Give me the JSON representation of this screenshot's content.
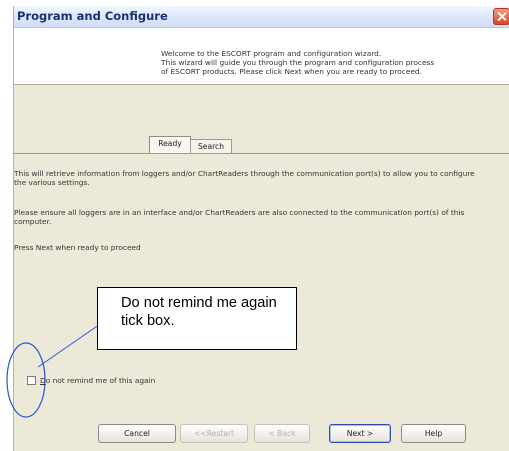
{
  "window": {
    "title": "Program and Configure"
  },
  "header": {
    "lines": [
      "Welcome to the ESCORT program and configuration wizard.",
      "This wizard will guide you through the program and configuration process",
      "of ESCORT products. Please click Next when you are ready to proceed."
    ]
  },
  "tabs": [
    {
      "label": "Ready",
      "selected": true
    },
    {
      "label": "Search",
      "selected": false
    }
  ],
  "content": {
    "paragraphs": [
      "This will retrieve information from loggers and/or ChartReaders through the communication port(s) to allow you to configure the various settings.",
      "Please ensure all loggers are in an interface and/or ChartReaders are also connected to the communication port(s) of this computer.",
      "Press Next when ready to proceed"
    ]
  },
  "checkbox": {
    "label_first": "D",
    "label_rest": "o not remind me of this again",
    "checked": false
  },
  "callout": {
    "text": "Do not remind me again tick box."
  },
  "buttons": {
    "cancel": "Cancel",
    "restart": "<<Restart",
    "back": "< Back",
    "next": "Next >",
    "help": "Help"
  },
  "colors": {
    "dialog_bg": "#ece9d8",
    "title_text": "#1b2f73",
    "annotation_blue": "#2a55d8"
  }
}
